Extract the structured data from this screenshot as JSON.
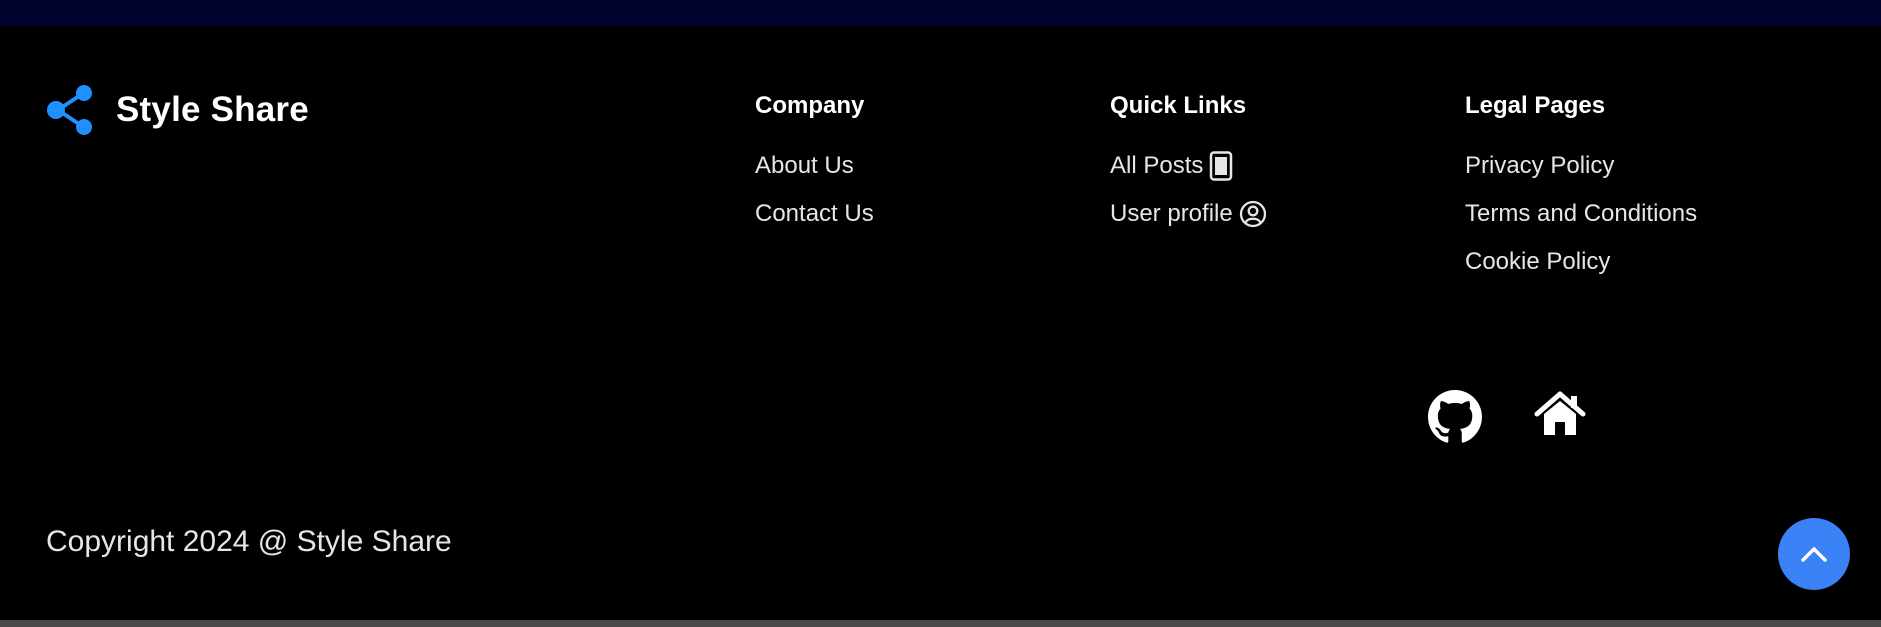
{
  "brand": {
    "name": "Style Share",
    "logo_icon": "share-nodes-icon",
    "logo_color": "#1e90ff"
  },
  "columns": [
    {
      "heading": "Company",
      "links": [
        {
          "label": "About Us"
        },
        {
          "label": "Contact Us"
        }
      ]
    },
    {
      "heading": "Quick Links",
      "links": [
        {
          "label": "All Posts",
          "icon": "phone-icon"
        },
        {
          "label": "User profile",
          "icon": "user-circle-icon"
        }
      ]
    },
    {
      "heading": "Legal Pages",
      "links": [
        {
          "label": "Privacy Policy"
        },
        {
          "label": "Terms and Conditions"
        },
        {
          "label": "Cookie Policy"
        }
      ]
    }
  ],
  "social": [
    {
      "icon": "github-icon"
    },
    {
      "icon": "home-icon"
    }
  ],
  "copyright": "Copyright 2024 @ Style Share",
  "scroll_top": {
    "icon": "chevron-up-icon",
    "color": "#3b82f6"
  },
  "colors": {
    "background": "#000000",
    "top_strip": "#01032e",
    "text": "#e6e6e6",
    "heading": "#ffffff"
  }
}
